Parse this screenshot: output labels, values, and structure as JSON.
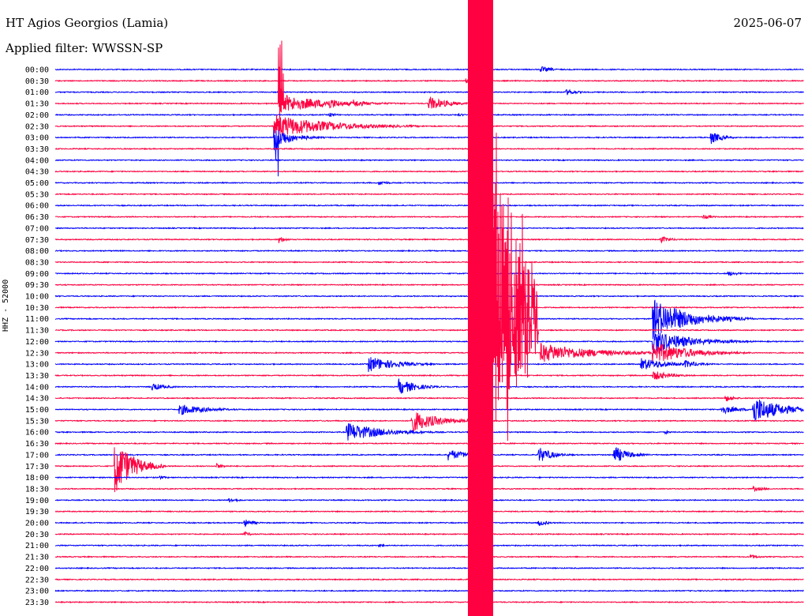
{
  "header": {
    "station": "HT Agios Georgios (Lamia)",
    "filter": "Applied filter: WWSSN-SP",
    "date": "2025-06-07"
  },
  "chart_data": {
    "type": "line",
    "title": "HT Agios Georgios (Lamia)",
    "subtitle": "Applied filter: WWSSN-SP",
    "date": "2025-06-07",
    "ylabel": "HHZ - 52000",
    "trace_rows": [
      "00:00",
      "00:30",
      "01:00",
      "01:30",
      "02:00",
      "02:30",
      "03:00",
      "03:30",
      "04:00",
      "04:30",
      "05:00",
      "05:30",
      "06:00",
      "06:30",
      "07:00",
      "07:30",
      "08:00",
      "08:30",
      "09:00",
      "09:30",
      "10:00",
      "10:30",
      "11:00",
      "11:30",
      "12:00",
      "12:30",
      "13:00",
      "13:30",
      "14:00",
      "14:30",
      "15:00",
      "15:30",
      "16:00",
      "16:30",
      "17:00",
      "17:30",
      "18:00",
      "18:30",
      "19:00",
      "19:30",
      "20:00",
      "20:30",
      "21:00",
      "21:30",
      "22:00",
      "22:30",
      "23:00",
      "23:30"
    ],
    "colors": {
      "even": "#0000ff",
      "odd": "#ff0040"
    },
    "events": [
      {
        "row": 0,
        "minute": 19.5,
        "amp": 4,
        "dur": 1.2
      },
      {
        "row": 1,
        "minute": 16.5,
        "amp": 3,
        "dur": 1.2
      },
      {
        "row": 2,
        "minute": 20.5,
        "amp": 4,
        "dur": 1.2
      },
      {
        "row": 3,
        "minute": 9.0,
        "amp": 12,
        "dur": 5,
        "spike": 90,
        "spikeDown": 30
      },
      {
        "row": 3,
        "minute": 11.0,
        "amp": 7,
        "dur": 1.5
      },
      {
        "row": 3,
        "minute": 12.0,
        "amp": 5,
        "dur": 1.5
      },
      {
        "row": 3,
        "minute": 15.0,
        "amp": 9,
        "dur": 2
      },
      {
        "row": 4,
        "minute": 11.0,
        "amp": 3,
        "dur": 0.8
      },
      {
        "row": 4,
        "minute": 16.2,
        "amp": 2,
        "dur": 0.6
      },
      {
        "row": 5,
        "minute": 8.8,
        "amp": 15,
        "dur": 6
      },
      {
        "row": 6,
        "minute": 8.8,
        "amp": 14,
        "dur": 2,
        "spikeDown": 55
      },
      {
        "row": 6,
        "minute": 26.3,
        "amp": 8,
        "dur": 1.2
      },
      {
        "row": 10,
        "minute": 13.0,
        "amp": 3,
        "dur": 1
      },
      {
        "row": 13,
        "minute": 17.0,
        "amp": 4,
        "dur": 1.2
      },
      {
        "row": 13,
        "minute": 26.0,
        "amp": 3,
        "dur": 1
      },
      {
        "row": 15,
        "minute": 9.0,
        "amp": 4,
        "dur": 0.8
      },
      {
        "row": 15,
        "minute": 24.3,
        "amp": 4,
        "dur": 1.2
      },
      {
        "row": 18,
        "minute": 27.0,
        "amp": 3,
        "dur": 1.2
      },
      {
        "row": 22,
        "minute": 24.0,
        "amp": 25,
        "dur": 4
      },
      {
        "row": 24,
        "minute": 24.0,
        "amp": 15,
        "dur": 4
      },
      {
        "row": 25,
        "minute": 19.5,
        "amp": 12,
        "dur": 6
      },
      {
        "row": 25,
        "minute": 24.0,
        "amp": 14,
        "dur": 4
      },
      {
        "row": 26,
        "minute": 12.6,
        "amp": 10,
        "dur": 3
      },
      {
        "row": 26,
        "minute": 23.5,
        "amp": 8,
        "dur": 3
      },
      {
        "row": 26,
        "minute": 25.3,
        "amp": 5,
        "dur": 1.5
      },
      {
        "row": 27,
        "minute": 24.0,
        "amp": 6,
        "dur": 2
      },
      {
        "row": 28,
        "minute": 3.9,
        "amp": 5,
        "dur": 1.5
      },
      {
        "row": 28,
        "minute": 13.8,
        "amp": 10,
        "dur": 2
      },
      {
        "row": 29,
        "minute": 26.9,
        "amp": 4,
        "dur": 1
      },
      {
        "row": 30,
        "minute": 5.0,
        "amp": 7,
        "dur": 3
      },
      {
        "row": 30,
        "minute": 26.7,
        "amp": 6,
        "dur": 2
      },
      {
        "row": 30,
        "minute": 28.0,
        "amp": 18,
        "dur": 3
      },
      {
        "row": 31,
        "minute": 14.3,
        "amp": 14,
        "dur": 3
      },
      {
        "row": 32,
        "minute": 11.7,
        "amp": 12,
        "dur": 4
      },
      {
        "row": 32,
        "minute": 24.5,
        "amp": 2,
        "dur": 0.6
      },
      {
        "row": 34,
        "minute": 15.8,
        "amp": 7,
        "dur": 2
      },
      {
        "row": 34,
        "minute": 19.4,
        "amp": 10,
        "dur": 1.5
      },
      {
        "row": 34,
        "minute": 22.4,
        "amp": 12,
        "dur": 1.5
      },
      {
        "row": 35,
        "minute": 2.4,
        "amp": 35,
        "dur": 2
      },
      {
        "row": 35,
        "minute": 6.5,
        "amp": 3,
        "dur": 1
      },
      {
        "row": 36,
        "minute": 4.2,
        "amp": 2,
        "dur": 1
      },
      {
        "row": 37,
        "minute": 28.0,
        "amp": 3,
        "dur": 1.5
      },
      {
        "row": 38,
        "minute": 7.0,
        "amp": 3,
        "dur": 1
      },
      {
        "row": 40,
        "minute": 7.6,
        "amp": 5,
        "dur": 1
      },
      {
        "row": 40,
        "minute": 19.4,
        "amp": 4,
        "dur": 1
      },
      {
        "row": 41,
        "minute": 7.6,
        "amp": 3,
        "dur": 0.8
      },
      {
        "row": 42,
        "minute": 13.0,
        "amp": 2,
        "dur": 0.8
      },
      {
        "row": 43,
        "minute": 27.9,
        "amp": 3,
        "dur": 1
      }
    ],
    "mainshock": {
      "minute": 17.5,
      "first_row": 0,
      "last_row": 47
    }
  }
}
